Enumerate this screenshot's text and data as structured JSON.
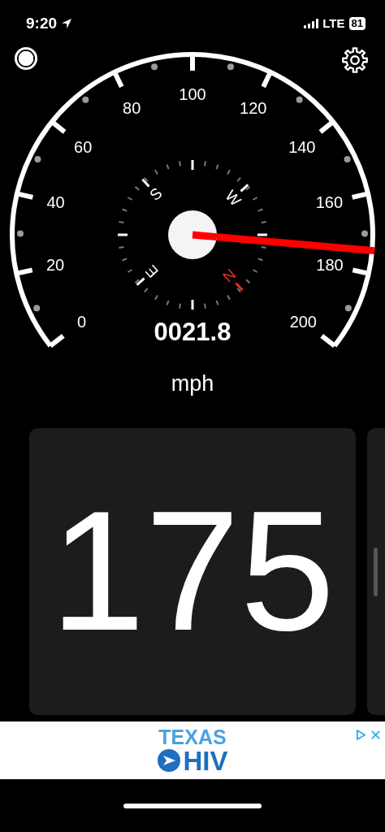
{
  "status_bar": {
    "time": "9:20",
    "network": "LTE",
    "battery": "81"
  },
  "gauge": {
    "scale_labels": [
      "0",
      "20",
      "40",
      "60",
      "80",
      "100",
      "120",
      "140",
      "160",
      "180",
      "200"
    ],
    "compass_letters": [
      {
        "text": "N",
        "color": "#e8321e"
      },
      {
        "text": "E",
        "color": "#ffffff"
      },
      {
        "text": "S",
        "color": "#ffffff"
      },
      {
        "text": "W",
        "color": "#ffffff"
      }
    ],
    "reading": "0021.8"
  },
  "unit": "mph",
  "card": {
    "value": "175"
  },
  "ad": {
    "line_1": "TEXAS",
    "line_2": "HIV"
  }
}
